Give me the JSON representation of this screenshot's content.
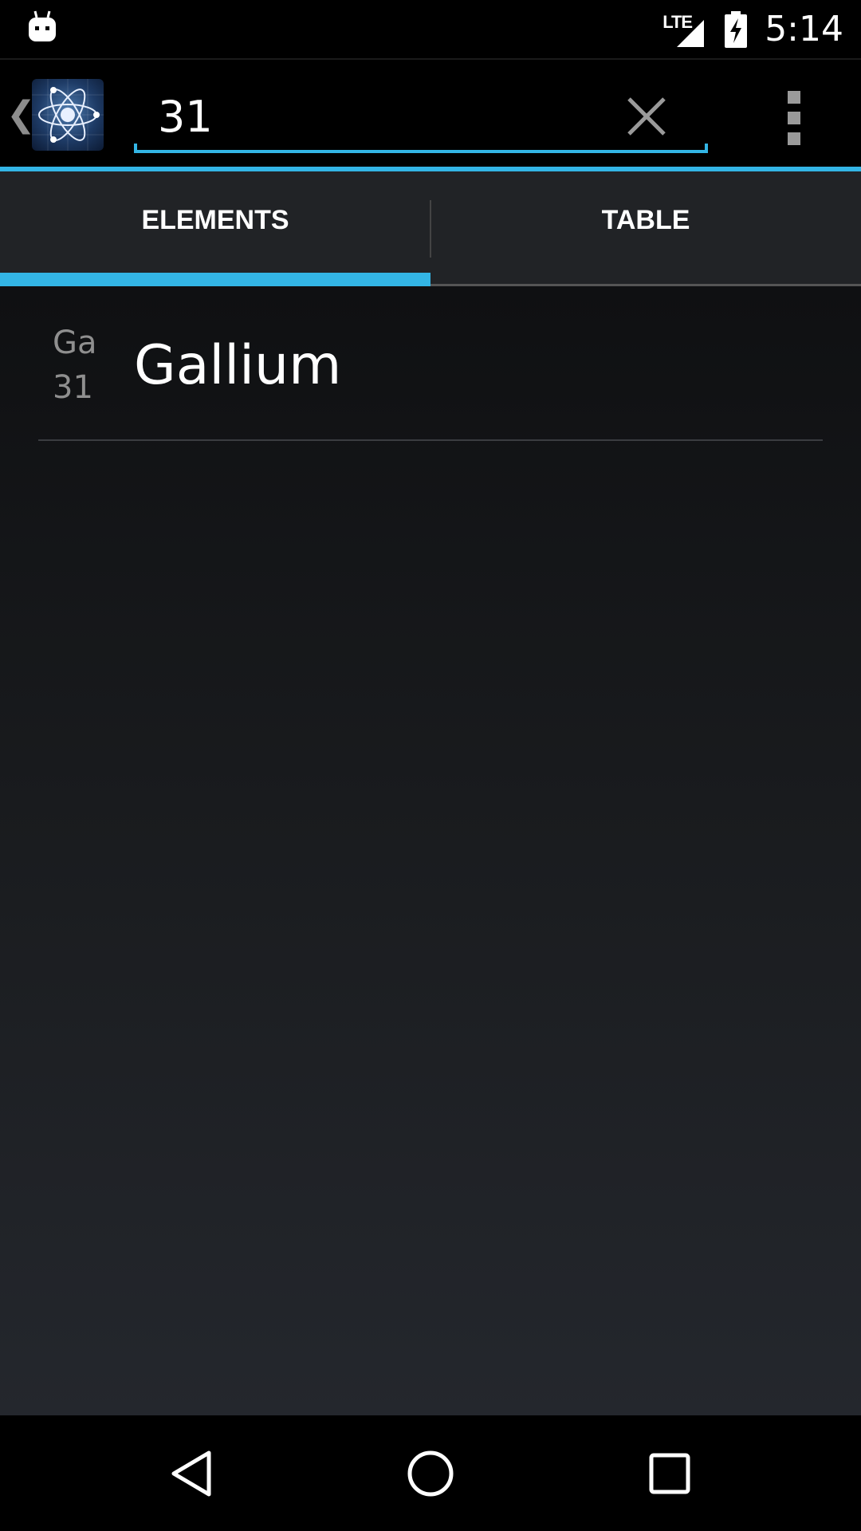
{
  "status_bar": {
    "network_type": "LTE",
    "time": "5:14",
    "icons": [
      "android-debug-icon",
      "lte-signal-icon",
      "battery-charging-icon"
    ]
  },
  "action_bar": {
    "app_icon": "atom-icon",
    "search": {
      "value": "31",
      "placeholder": ""
    },
    "icons": [
      "up-chevron-icon",
      "clear-icon",
      "overflow-menu-icon"
    ]
  },
  "tabs": [
    {
      "label": "ELEMENTS",
      "selected": true
    },
    {
      "label": "TABLE",
      "selected": false
    }
  ],
  "results": [
    {
      "symbol": "Ga",
      "number": "31",
      "name": "Gallium"
    }
  ],
  "nav_bar": {
    "icons": [
      "back-icon",
      "home-icon",
      "recents-icon"
    ]
  },
  "colors": {
    "accent": "#33b5e5",
    "tab_bar_bg": "#212326",
    "background_top": "#0f1012",
    "background_bottom": "#24272d"
  }
}
